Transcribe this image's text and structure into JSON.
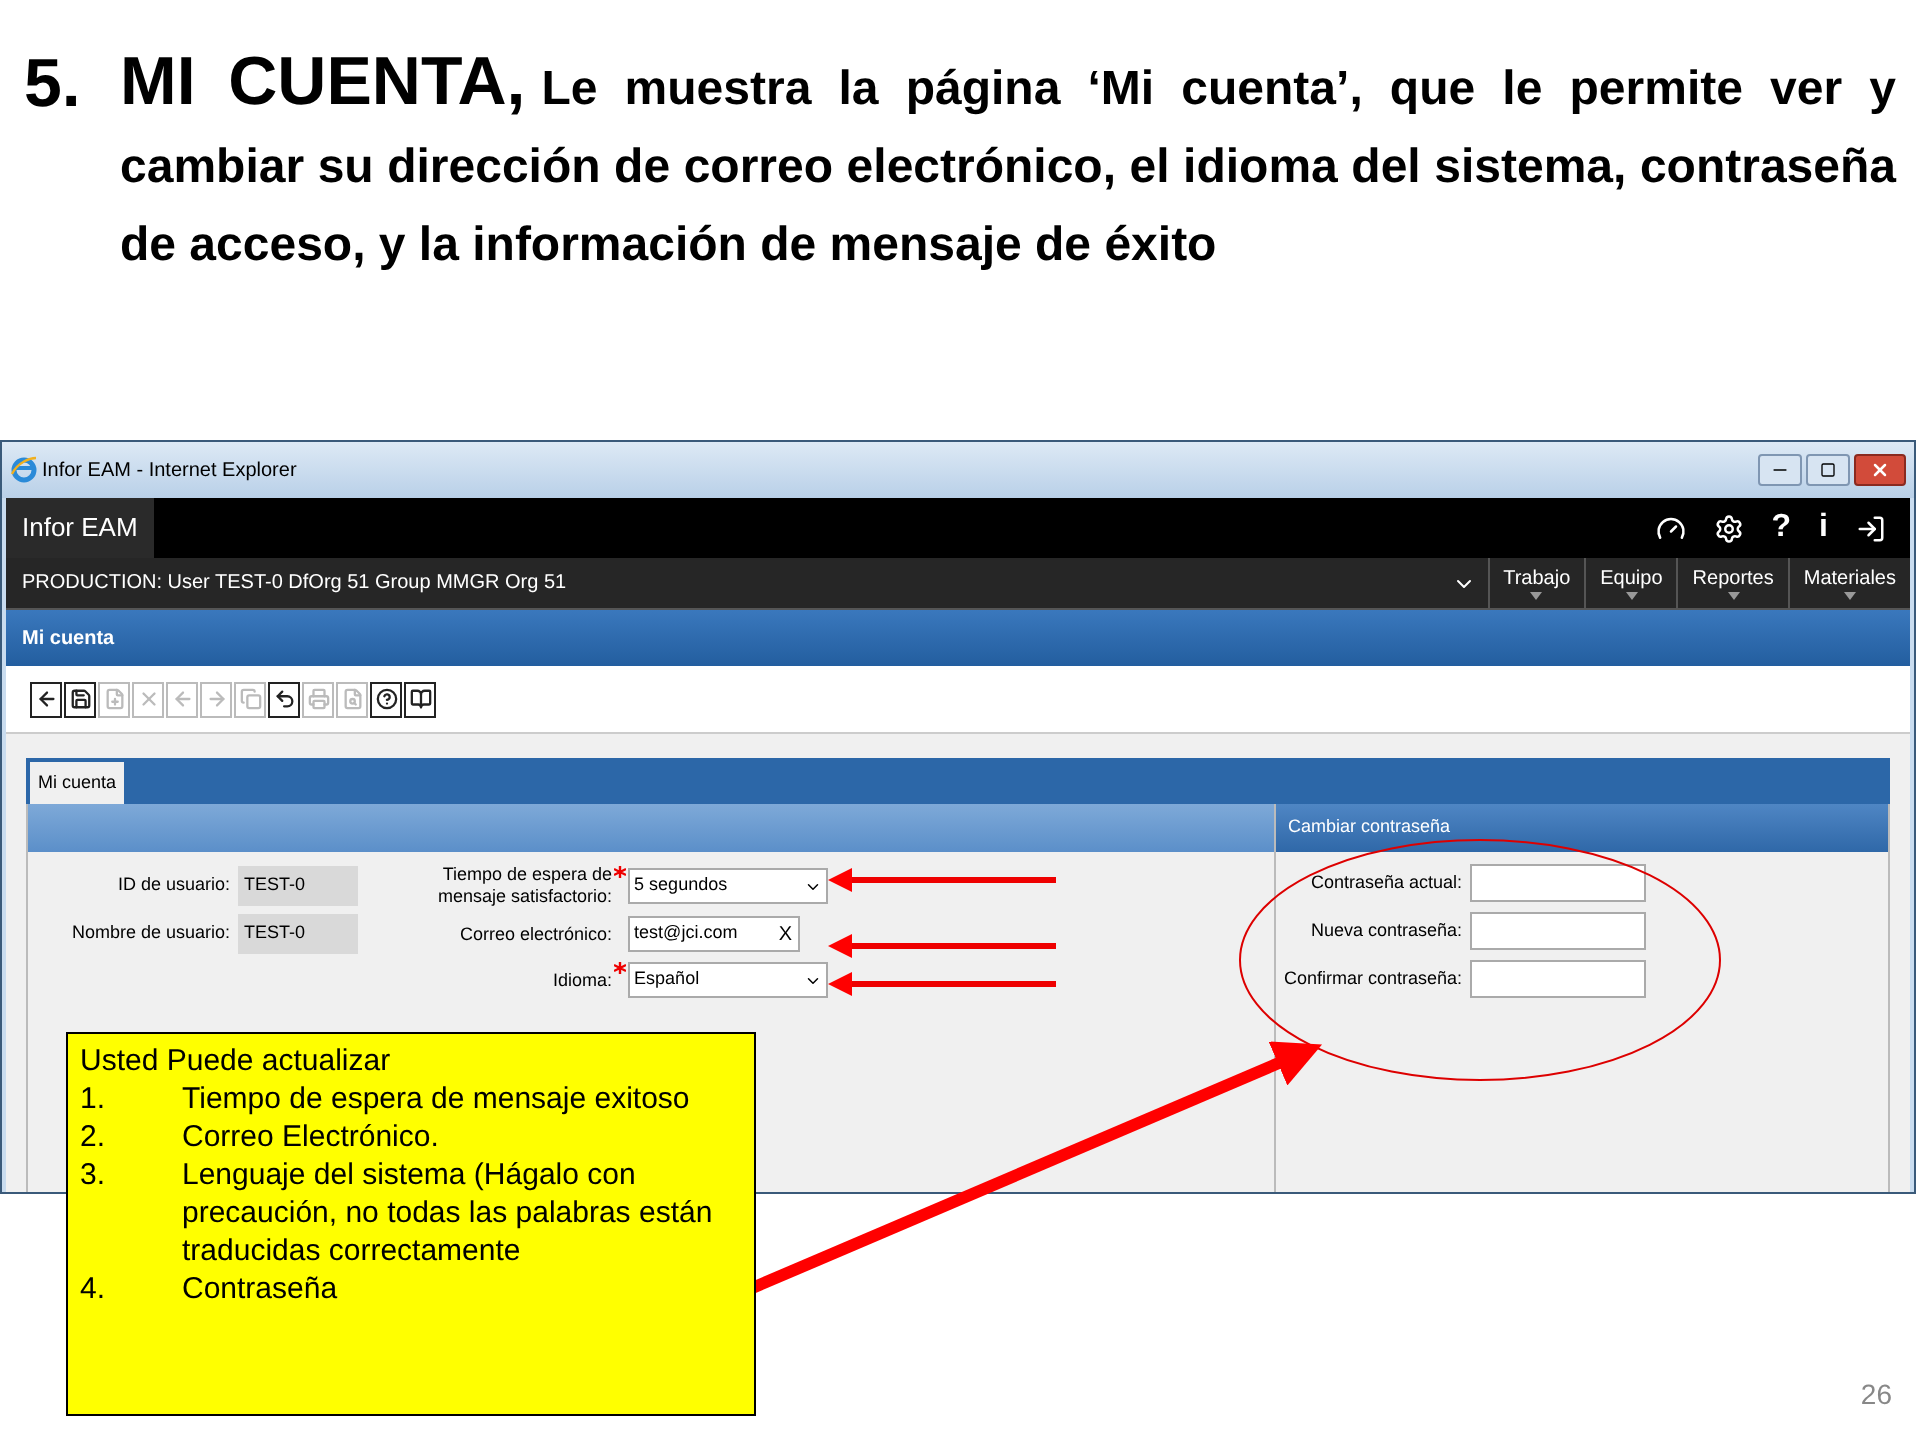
{
  "slide": {
    "number": "5.",
    "title": "MI CUENTA,",
    "text": "Le muestra la página ‘Mi cuenta’, que le permite ver y cambiar su dirección de correo electrónico, el idioma del sistema, contraseña de acceso, y la información de mensaje de éxito",
    "page_number": "26"
  },
  "window": {
    "title": "Infor EAM - Internet Explorer"
  },
  "app": {
    "name": "Infor EAM",
    "help_glyph": "?",
    "info_glyph": "i",
    "session": "PRODUCTION: User TEST-0 DfOrg 51 Group MMGR Org 51",
    "menu": [
      {
        "label": "Trabajo"
      },
      {
        "label": "Equipo"
      },
      {
        "label": "Reportes"
      },
      {
        "label": "Materiales"
      }
    ],
    "page_title": "Mi cuenta"
  },
  "toolbar": [
    {
      "kind": "back",
      "disabled": false
    },
    {
      "kind": "save",
      "disabled": false
    },
    {
      "kind": "new",
      "disabled": true
    },
    {
      "kind": "delete",
      "disabled": true
    },
    {
      "kind": "prev",
      "disabled": true
    },
    {
      "kind": "next",
      "disabled": true
    },
    {
      "kind": "copy",
      "disabled": true
    },
    {
      "kind": "undo",
      "disabled": false
    },
    {
      "kind": "print",
      "disabled": true
    },
    {
      "kind": "preview",
      "disabled": true
    },
    {
      "kind": "help",
      "disabled": false
    },
    {
      "kind": "book",
      "disabled": false
    }
  ],
  "tabs": [
    {
      "label": "Mi cuenta",
      "selected": true
    }
  ],
  "user_fields": [
    {
      "label": "ID de usuario:",
      "value": "TEST-0"
    },
    {
      "label": "Nombre de usuario:",
      "value": "TEST-0"
    }
  ],
  "settings_fields": [
    {
      "kind": "select",
      "label_lines": [
        "Tiempo de espera de",
        "mensaje satisfactorio:"
      ],
      "required": true,
      "value": "5 segundos"
    },
    {
      "kind": "text",
      "label_lines": [
        "Correo electrónico:"
      ],
      "required": false,
      "value": "test@jci.com",
      "clear": "X"
    },
    {
      "kind": "select",
      "label_lines": [
        "Idioma:"
      ],
      "required": true,
      "value": "Español"
    }
  ],
  "password_panel": {
    "title": "Cambiar contraseña",
    "fields": [
      {
        "label": "Contraseña actual:"
      },
      {
        "label": "Nueva contraseña:"
      },
      {
        "label": "Confirmar contraseña:"
      }
    ]
  },
  "callout": {
    "title": "Usted Puede actualizar",
    "items": [
      {
        "number": "1.",
        "text": "Tiempo de espera de mensaje exitoso"
      },
      {
        "number": "2.",
        "text": "Correo Electrónico."
      },
      {
        "number": "3.",
        "text": "Lenguaje del sistema (Hágalo con precaución, no todas las palabras están traducidas correctamente"
      },
      {
        "number": "4.",
        "text": "Contraseña"
      }
    ]
  }
}
